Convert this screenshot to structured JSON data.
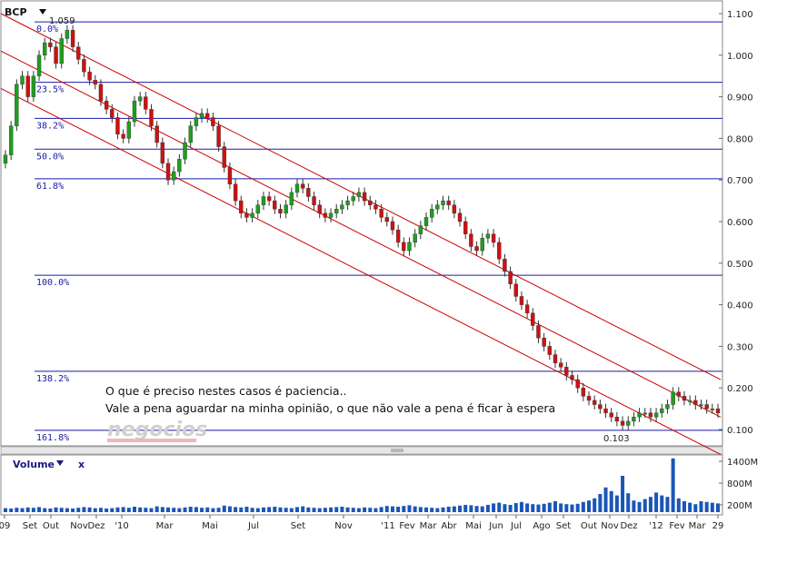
{
  "symbol": "BCP",
  "volume_label": "Volume",
  "close_symbol": "x",
  "watermark": "negocios",
  "annotation_lines": [
    "O que é preciso nestes casos é paciencia..",
    "Vale a pena aguardar na minha opinião, o que não vale a pena é ficar à espera"
  ],
  "colors": {
    "up": "#1f9e1f",
    "down": "#cc1111",
    "fib": "#1a1aa8",
    "channel": "#cc0000",
    "volume": "#1a56b8",
    "grid": "#9aa8c8",
    "text": "#1a1aa8"
  },
  "chart_data": [
    {
      "type": "candlestick",
      "title": "BCP",
      "ylim": [
        0.06,
        1.1
      ],
      "y_ticks": [
        "1.100",
        "1.000",
        "0.900",
        "0.800",
        "0.700",
        "0.600",
        "0.500",
        "0.400",
        "0.300",
        "0.200",
        "0.100"
      ],
      "x_ticks": [
        "09",
        "Set",
        "Out",
        "Nov",
        "Dez",
        "'10",
        "Mar",
        "Mai",
        "Jul",
        "Set",
        "Nov",
        "'11",
        "Fev",
        "Mar",
        "Abr",
        "Mai",
        "Jun",
        "Jul",
        "Ago",
        "Set",
        "Out",
        "Nov",
        "Dez",
        "'12",
        "Fev",
        "Mar",
        "29"
      ],
      "high_label": "1.059",
      "low_label": "0.103",
      "fibonacci_levels": [
        {
          "label": "0.0%",
          "value": 1.08
        },
        {
          "label": "23.5%",
          "value": 0.935
        },
        {
          "label": "38.2%",
          "value": 0.848
        },
        {
          "label": "50.0%",
          "value": 0.774
        },
        {
          "label": "61.8%",
          "value": 0.703
        },
        {
          "label": "100.0%",
          "value": 0.471
        },
        {
          "label": "138.2%",
          "value": 0.24
        },
        {
          "label": "161.8%",
          "value": 0.098
        }
      ],
      "channel_lines": [
        {
          "start": 1.1,
          "end": 0.22
        },
        {
          "start": 1.01,
          "end": 0.13
        },
        {
          "start": 0.92,
          "end": 0.04
        }
      ],
      "closes": [
        0.76,
        0.83,
        0.93,
        0.95,
        0.9,
        0.95,
        1.0,
        1.03,
        1.02,
        0.98,
        1.04,
        1.06,
        1.02,
        0.99,
        0.96,
        0.94,
        0.93,
        0.89,
        0.87,
        0.85,
        0.81,
        0.8,
        0.84,
        0.89,
        0.9,
        0.87,
        0.83,
        0.79,
        0.74,
        0.7,
        0.72,
        0.75,
        0.79,
        0.83,
        0.85,
        0.86,
        0.85,
        0.83,
        0.78,
        0.73,
        0.69,
        0.65,
        0.62,
        0.61,
        0.62,
        0.64,
        0.66,
        0.65,
        0.63,
        0.62,
        0.64,
        0.67,
        0.69,
        0.68,
        0.66,
        0.64,
        0.62,
        0.61,
        0.62,
        0.63,
        0.64,
        0.65,
        0.66,
        0.67,
        0.65,
        0.64,
        0.63,
        0.61,
        0.6,
        0.58,
        0.55,
        0.53,
        0.55,
        0.57,
        0.59,
        0.61,
        0.63,
        0.64,
        0.65,
        0.64,
        0.62,
        0.6,
        0.57,
        0.54,
        0.53,
        0.56,
        0.57,
        0.55,
        0.51,
        0.48,
        0.45,
        0.42,
        0.4,
        0.38,
        0.35,
        0.32,
        0.3,
        0.28,
        0.26,
        0.25,
        0.23,
        0.22,
        0.2,
        0.18,
        0.17,
        0.16,
        0.15,
        0.14,
        0.13,
        0.12,
        0.11,
        0.12,
        0.13,
        0.14,
        0.14,
        0.13,
        0.14,
        0.15,
        0.16,
        0.19,
        0.18,
        0.17,
        0.17,
        0.16,
        0.16,
        0.15,
        0.15,
        0.14
      ],
      "volumes": [
        110,
        100,
        120,
        110,
        130,
        120,
        140,
        110,
        100,
        130,
        120,
        110,
        100,
        120,
        140,
        130,
        110,
        120,
        100,
        110,
        130,
        140,
        120,
        150,
        130,
        120,
        110,
        160,
        140,
        130,
        120,
        110,
        130,
        150,
        140,
        120,
        130,
        110,
        120,
        180,
        160,
        140,
        130,
        150,
        120,
        110,
        130,
        140,
        150,
        130,
        120,
        110,
        140,
        160,
        130,
        120,
        110,
        120,
        130,
        140,
        150,
        130,
        120,
        110,
        130,
        120,
        110,
        140,
        170,
        160,
        150,
        170,
        190,
        160,
        140,
        130,
        120,
        110,
        130,
        150,
        160,
        180,
        200,
        190,
        170,
        160,
        200,
        240,
        260,
        220,
        200,
        250,
        280,
        240,
        220,
        210,
        230,
        260,
        300,
        240,
        220,
        210,
        230,
        280,
        320,
        380,
        500,
        680,
        580,
        460,
        1000,
        520,
        320,
        280,
        360,
        420,
        540,
        460,
        420,
        1480,
        380,
        300,
        260,
        220,
        300,
        280,
        260,
        240
      ]
    },
    {
      "type": "bar",
      "title": "Volume",
      "y_ticks": [
        "1400M",
        "800M",
        "200M"
      ],
      "ylim": [
        0,
        1500
      ]
    }
  ]
}
